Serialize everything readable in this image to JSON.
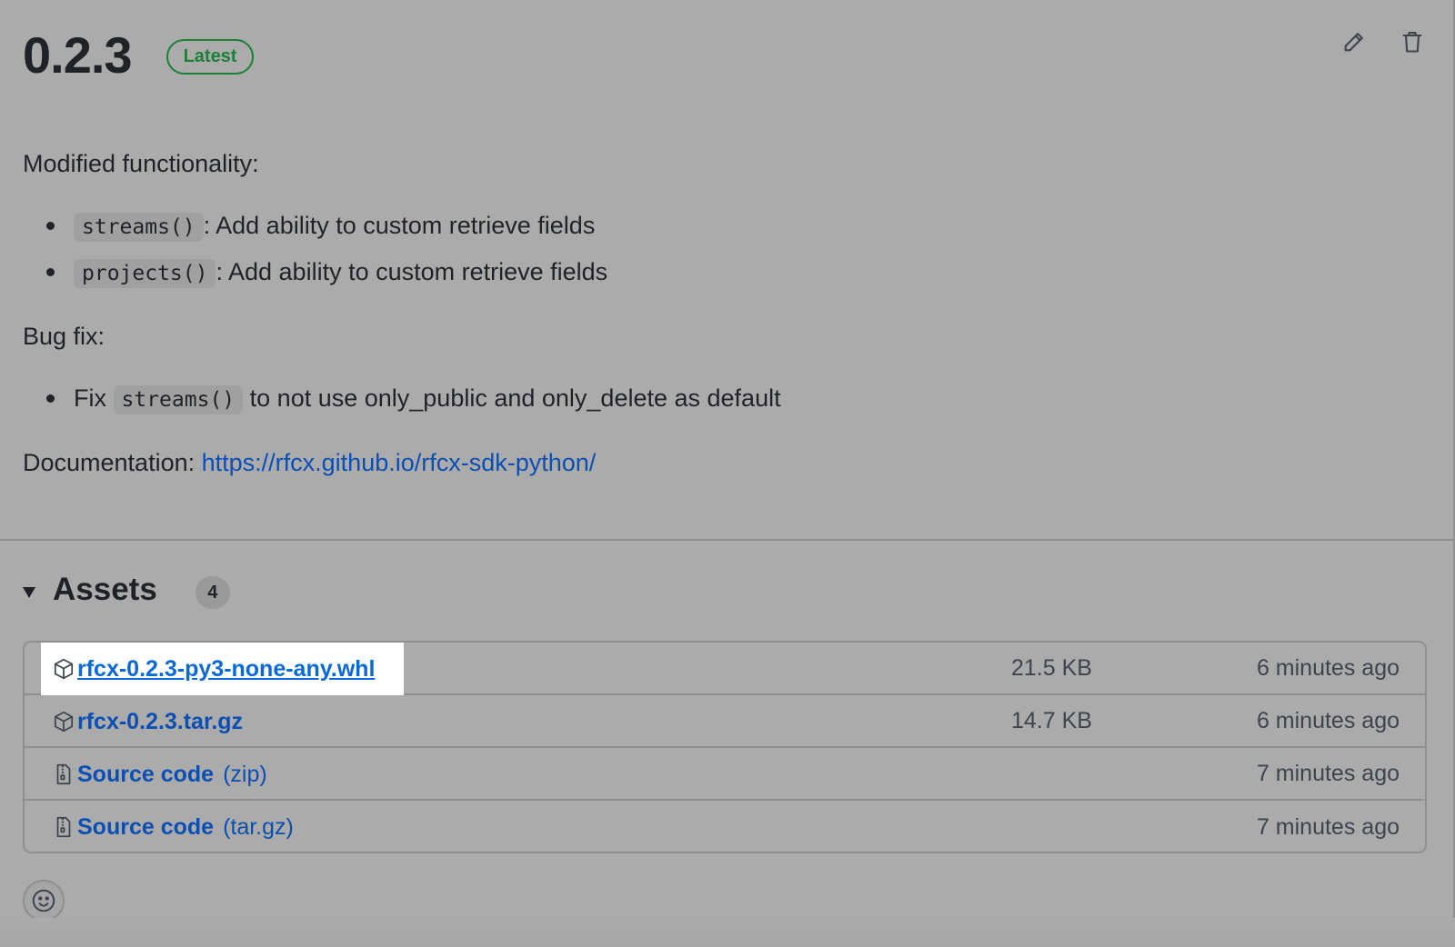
{
  "release": {
    "version": "0.2.3",
    "badge": "Latest",
    "actions": {
      "edit_icon": "pencil-icon",
      "delete_icon": "trash-icon"
    }
  },
  "notes": {
    "modified_heading": "Modified functionality:",
    "modified_items": [
      {
        "code": "streams()",
        "text": ": Add ability to custom retrieve fields"
      },
      {
        "code": "projects()",
        "text": ": Add ability to custom retrieve fields"
      }
    ],
    "bugfix_heading": "Bug fix:",
    "bugfix_items": [
      {
        "prefix": "Fix",
        "code": "streams()",
        "text": "to not use only_public and only_delete as default"
      }
    ],
    "doc_label": "Documentation:",
    "doc_link": "https://rfcx.github.io/rfcx-sdk-python/"
  },
  "assets": {
    "title": "Assets",
    "count": "4",
    "rows": [
      {
        "icon": "package-icon",
        "name": "rfcx-0.2.3-py3-none-any.whl",
        "suffix": "",
        "size": "21.5 KB",
        "time": "6 minutes ago"
      },
      {
        "icon": "package-icon",
        "name": "rfcx-0.2.3.tar.gz",
        "suffix": "",
        "size": "14.7 KB",
        "time": "6 minutes ago"
      },
      {
        "icon": "file-zip-icon",
        "name": "Source code",
        "suffix": "(zip)",
        "size": "",
        "time": "7 minutes ago"
      },
      {
        "icon": "file-zip-icon",
        "name": "Source code",
        "suffix": "(tar.gz)",
        "size": "",
        "time": "7 minutes ago"
      }
    ]
  },
  "reactions": {
    "icon": "smiley-icon"
  },
  "colors": {
    "accent_link": "#0969da",
    "success": "#1a7f37",
    "background": "#ababab"
  }
}
